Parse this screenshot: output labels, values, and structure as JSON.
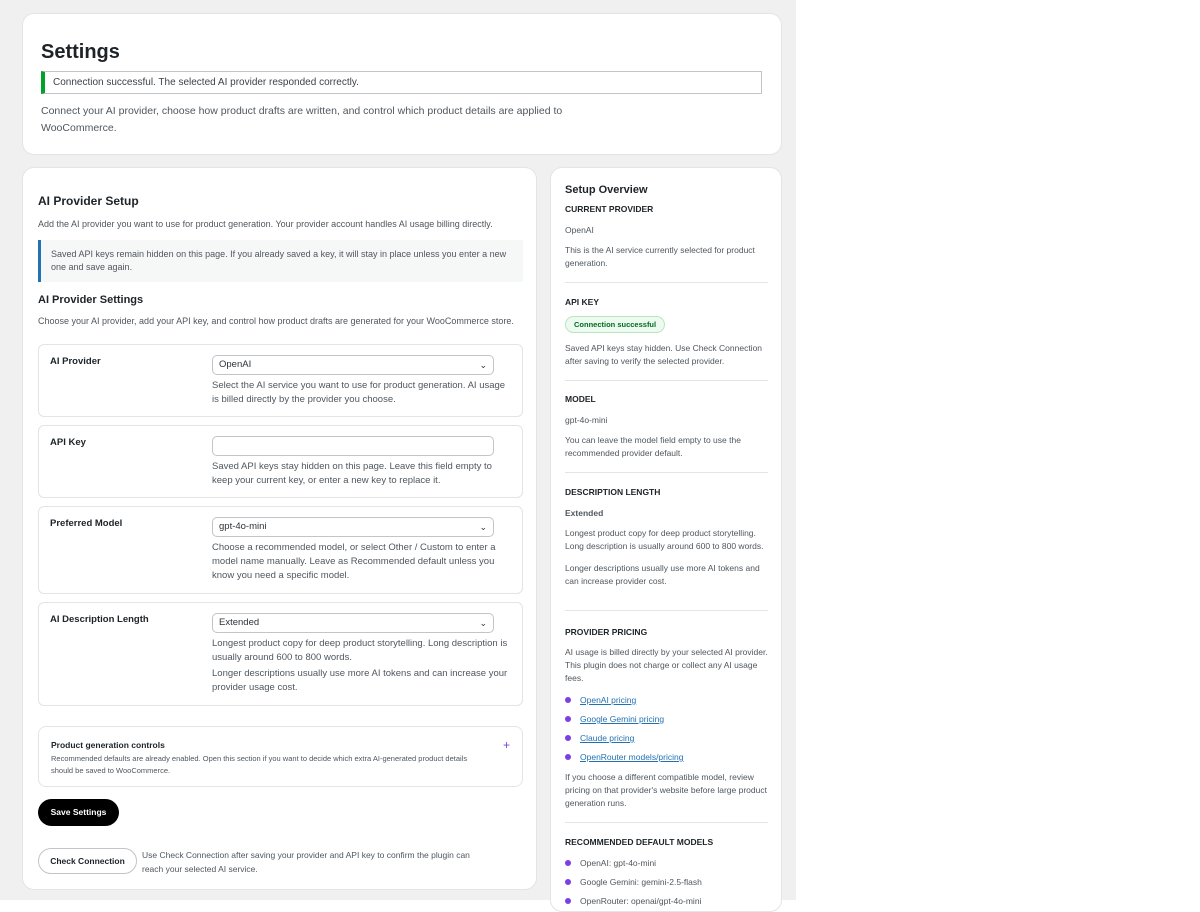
{
  "header": {
    "title": "Settings",
    "notice": "Connection successful. The selected AI provider responded correctly.",
    "description": "Connect your AI provider, choose how product drafts are written, and control which product details are applied to WooCommerce."
  },
  "main": {
    "section_title": "AI Provider Setup",
    "section_desc": "Add the AI provider you want to use for product generation. Your provider account handles AI usage billing directly.",
    "info_note": "Saved API keys remain hidden on this page. If you already saved a key, it will stay in place unless you enter a new one and save again.",
    "settings_title": "AI Provider Settings",
    "settings_desc": "Choose your AI provider, add your API key, and control how product drafts are generated for your WooCommerce store.",
    "fields": {
      "provider": {
        "label": "AI Provider",
        "value": "OpenAI",
        "help": "Select the AI service you want to use for product generation. AI usage is billed directly by the provider you choose."
      },
      "api_key": {
        "label": "API Key",
        "value": "",
        "help": "Saved API keys stay hidden on this page. Leave this field empty to keep your current key, or enter a new key to replace it."
      },
      "model": {
        "label": "Preferred Model",
        "value": "gpt-4o-mini",
        "help": "Choose a recommended model, or select Other / Custom to enter a model name manually. Leave as Recommended default unless you know you need a specific model."
      },
      "length": {
        "label": "AI Description Length",
        "value": "Extended",
        "help": "Longest product copy for deep product storytelling. Long description is usually around 600 to 800 words.",
        "help2": "Longer descriptions usually use more AI tokens and can increase your provider usage cost."
      }
    },
    "controls": {
      "title": "Product generation controls",
      "desc": "Recommended defaults are already enabled. Open this section if you want to decide which extra AI-generated product details should be saved to WooCommerce.",
      "toggle": "+"
    },
    "save_label": "Save Settings",
    "check_label": "Check Connection",
    "check_note": "Use Check Connection after saving your provider and API key to confirm the plugin can reach your selected AI service."
  },
  "sidebar": {
    "title": "Setup Overview",
    "provider": {
      "heading": "CURRENT PROVIDER",
      "value": "OpenAI",
      "text": "This is the AI service currently selected for product generation."
    },
    "api_key": {
      "heading": "API KEY",
      "badge": "Connection successful",
      "text": "Saved API keys stay hidden. Use Check Connection after saving to verify the selected provider."
    },
    "model": {
      "heading": "MODEL",
      "value": "gpt-4o-mini",
      "text": "You can leave the model field empty to use the recommended provider default."
    },
    "length": {
      "heading": "DESCRIPTION LENGTH",
      "value": "Extended",
      "text": "Longest product copy for deep product storytelling. Long description is usually around 600 to 800 words.",
      "text2": "Longer descriptions usually use more AI tokens and can increase provider cost."
    },
    "pricing": {
      "heading": "PROVIDER PRICING",
      "text": "AI usage is billed directly by your selected AI provider. This plugin does not charge or collect any AI usage fees.",
      "links": [
        "OpenAI pricing",
        "Google Gemini pricing",
        "Claude pricing",
        "OpenRouter models/pricing"
      ],
      "text2": "If you choose a different compatible model, review pricing on that provider's website before large product generation runs."
    },
    "defaults": {
      "heading": "RECOMMENDED DEFAULT MODELS",
      "items": [
        "OpenAI: gpt-4o-mini",
        "Google Gemini: gemini-2.5-flash",
        "OpenRouter: openai/gpt-4o-mini"
      ]
    }
  },
  "colors": {
    "accent": "#7b3fe4",
    "success": "#00a32a",
    "link": "#2271b1",
    "button": "#000000"
  }
}
